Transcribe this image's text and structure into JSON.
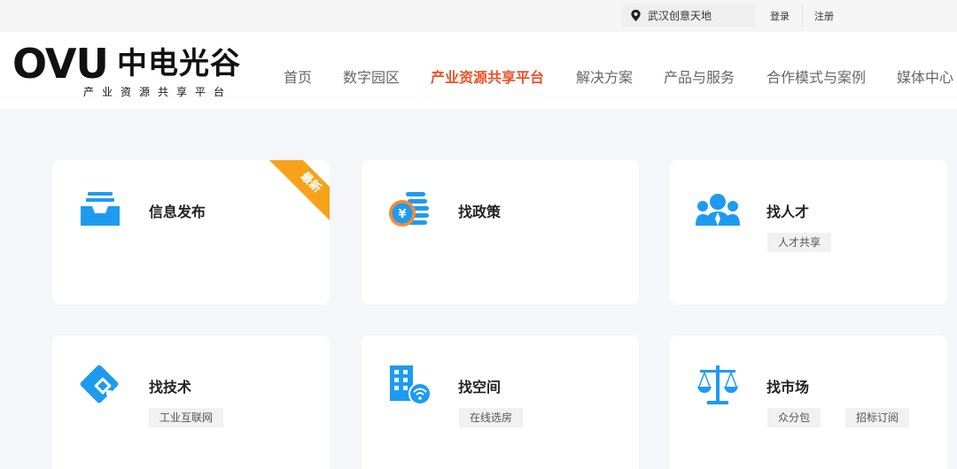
{
  "topbar": {
    "location": "武汉创意天地",
    "login": "登录",
    "register": "注册"
  },
  "logo": {
    "brand": "OVU",
    "name": "中电光谷",
    "tagline": "产业资源共享平台"
  },
  "nav": {
    "items": [
      {
        "label": "首页"
      },
      {
        "label": "数字园区"
      },
      {
        "label": "产业资源共享平台"
      },
      {
        "label": "解决方案"
      },
      {
        "label": "产品与服务"
      },
      {
        "label": "合作模式与案例"
      },
      {
        "label": "媒体中心"
      }
    ],
    "active_index": 2
  },
  "cards": [
    {
      "title": "信息发布",
      "icon": "inbox-tray-icon",
      "badge": "最新",
      "tags": []
    },
    {
      "title": "找政策",
      "icon": "coin-stack-icon",
      "tags": []
    },
    {
      "title": "找人才",
      "icon": "people-group-icon",
      "tags": [
        "人才共享"
      ]
    },
    {
      "title": "找技术",
      "icon": "tech-chip-card-icon",
      "tags": [
        "工业互联网"
      ]
    },
    {
      "title": "找空间",
      "icon": "building-wifi-icon",
      "tags": [
        "在线选房"
      ]
    },
    {
      "title": "找市场",
      "icon": "balance-scale-icon",
      "tags": [
        "众分包",
        "招标订阅"
      ]
    }
  ],
  "colors": {
    "accent": "#e8542a",
    "icon_blue": "#1d9bf0",
    "ribbon": "#f7a21b",
    "background": "#f4f6f9"
  }
}
